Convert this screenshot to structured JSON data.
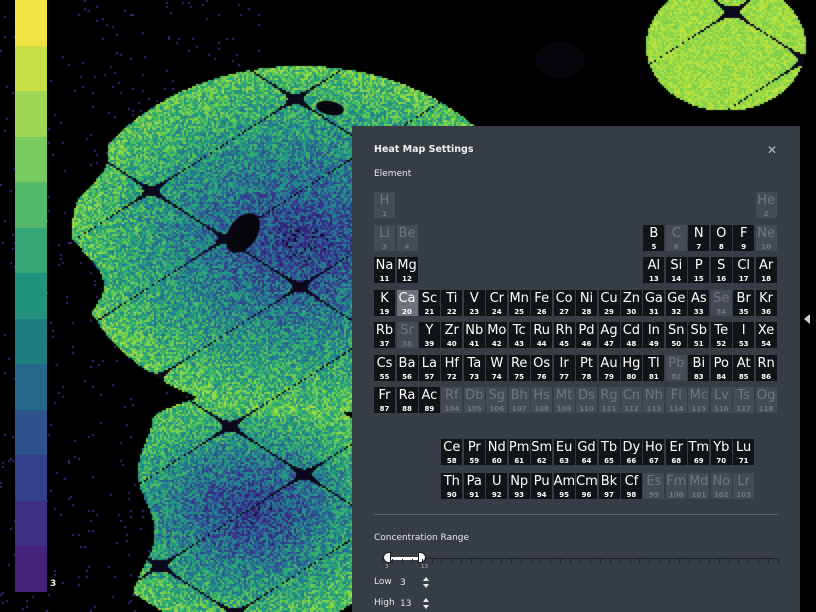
{
  "colorbar": {
    "label": "3",
    "colors": [
      "#f0e442",
      "#c8df48",
      "#9fd653",
      "#78c95e",
      "#54b86b",
      "#35a676",
      "#22927c",
      "#1f7e82",
      "#256889",
      "#2e538c",
      "#35408c",
      "#3b2f86",
      "#43237a"
    ]
  },
  "panel": {
    "title": "Heat Map Settings",
    "element_label": "Element",
    "selected_element": "Ca",
    "elements": [
      {
        "s": "H",
        "n": 1,
        "active": false
      },
      {
        "s": "He",
        "n": 2,
        "active": false
      },
      {
        "s": "Li",
        "n": 3,
        "active": false
      },
      {
        "s": "Be",
        "n": 4,
        "active": false
      },
      {
        "s": "B",
        "n": 5,
        "active": true
      },
      {
        "s": "C",
        "n": 6,
        "active": false
      },
      {
        "s": "N",
        "n": 7,
        "active": true
      },
      {
        "s": "O",
        "n": 8,
        "active": true
      },
      {
        "s": "F",
        "n": 9,
        "active": true
      },
      {
        "s": "Ne",
        "n": 10,
        "active": false
      },
      {
        "s": "Na",
        "n": 11,
        "active": true
      },
      {
        "s": "Mg",
        "n": 12,
        "active": true
      },
      {
        "s": "Al",
        "n": 13,
        "active": true
      },
      {
        "s": "Si",
        "n": 14,
        "active": true
      },
      {
        "s": "P",
        "n": 15,
        "active": true
      },
      {
        "s": "S",
        "n": 16,
        "active": true
      },
      {
        "s": "Cl",
        "n": 17,
        "active": true
      },
      {
        "s": "Ar",
        "n": 18,
        "active": true
      },
      {
        "s": "K",
        "n": 19,
        "active": true
      },
      {
        "s": "Ca",
        "n": 20,
        "active": true
      },
      {
        "s": "Sc",
        "n": 21,
        "active": true
      },
      {
        "s": "Ti",
        "n": 22,
        "active": true
      },
      {
        "s": "V",
        "n": 23,
        "active": true
      },
      {
        "s": "Cr",
        "n": 24,
        "active": true
      },
      {
        "s": "Mn",
        "n": 25,
        "active": true
      },
      {
        "s": "Fe",
        "n": 26,
        "active": true
      },
      {
        "s": "Co",
        "n": 27,
        "active": true
      },
      {
        "s": "Ni",
        "n": 28,
        "active": true
      },
      {
        "s": "Cu",
        "n": 29,
        "active": true
      },
      {
        "s": "Zn",
        "n": 30,
        "active": true
      },
      {
        "s": "Ga",
        "n": 31,
        "active": true
      },
      {
        "s": "Ge",
        "n": 32,
        "active": true
      },
      {
        "s": "As",
        "n": 33,
        "active": true
      },
      {
        "s": "Se",
        "n": 34,
        "active": false
      },
      {
        "s": "Br",
        "n": 35,
        "active": true
      },
      {
        "s": "Kr",
        "n": 36,
        "active": true
      },
      {
        "s": "Rb",
        "n": 37,
        "active": true
      },
      {
        "s": "Sr",
        "n": 38,
        "active": false
      },
      {
        "s": "Y",
        "n": 39,
        "active": true
      },
      {
        "s": "Zr",
        "n": 40,
        "active": true
      },
      {
        "s": "Nb",
        "n": 41,
        "active": true
      },
      {
        "s": "Mo",
        "n": 42,
        "active": true
      },
      {
        "s": "Tc",
        "n": 43,
        "active": true
      },
      {
        "s": "Ru",
        "n": 44,
        "active": true
      },
      {
        "s": "Rh",
        "n": 45,
        "active": true
      },
      {
        "s": "Pd",
        "n": 46,
        "active": true
      },
      {
        "s": "Ag",
        "n": 47,
        "active": true
      },
      {
        "s": "Cd",
        "n": 48,
        "active": true
      },
      {
        "s": "In",
        "n": 49,
        "active": true
      },
      {
        "s": "Sn",
        "n": 50,
        "active": true
      },
      {
        "s": "Sb",
        "n": 51,
        "active": true
      },
      {
        "s": "Te",
        "n": 52,
        "active": true
      },
      {
        "s": "I",
        "n": 53,
        "active": true
      },
      {
        "s": "Xe",
        "n": 54,
        "active": true
      },
      {
        "s": "Cs",
        "n": 55,
        "active": true
      },
      {
        "s": "Ba",
        "n": 56,
        "active": true
      },
      {
        "s": "La",
        "n": 57,
        "active": true
      },
      {
        "s": "Hf",
        "n": 72,
        "active": true
      },
      {
        "s": "Ta",
        "n": 73,
        "active": true
      },
      {
        "s": "W",
        "n": 74,
        "active": true
      },
      {
        "s": "Re",
        "n": 75,
        "active": true
      },
      {
        "s": "Os",
        "n": 76,
        "active": true
      },
      {
        "s": "Ir",
        "n": 77,
        "active": true
      },
      {
        "s": "Pt",
        "n": 78,
        "active": true
      },
      {
        "s": "Au",
        "n": 79,
        "active": true
      },
      {
        "s": "Hg",
        "n": 80,
        "active": true
      },
      {
        "s": "Tl",
        "n": 81,
        "active": true
      },
      {
        "s": "Pb",
        "n": 82,
        "active": false
      },
      {
        "s": "Bi",
        "n": 83,
        "active": true
      },
      {
        "s": "Po",
        "n": 84,
        "active": true
      },
      {
        "s": "At",
        "n": 85,
        "active": true
      },
      {
        "s": "Rn",
        "n": 86,
        "active": true
      },
      {
        "s": "Fr",
        "n": 87,
        "active": true
      },
      {
        "s": "Ra",
        "n": 88,
        "active": true
      },
      {
        "s": "Ac",
        "n": 89,
        "active": true
      },
      {
        "s": "Rf",
        "n": 104,
        "active": false
      },
      {
        "s": "Db",
        "n": 105,
        "active": false
      },
      {
        "s": "Sg",
        "n": 106,
        "active": false
      },
      {
        "s": "Bh",
        "n": 107,
        "active": false
      },
      {
        "s": "Hs",
        "n": 108,
        "active": false
      },
      {
        "s": "Mt",
        "n": 109,
        "active": false
      },
      {
        "s": "Ds",
        "n": 110,
        "active": false
      },
      {
        "s": "Rg",
        "n": 111,
        "active": false
      },
      {
        "s": "Cn",
        "n": 112,
        "active": false
      },
      {
        "s": "Nh",
        "n": 113,
        "active": false
      },
      {
        "s": "Fl",
        "n": 114,
        "active": false
      },
      {
        "s": "Mc",
        "n": 115,
        "active": false
      },
      {
        "s": "Lv",
        "n": 116,
        "active": false
      },
      {
        "s": "Ts",
        "n": 117,
        "active": false
      },
      {
        "s": "Og",
        "n": 118,
        "active": false
      },
      {
        "s": "Ce",
        "n": 58,
        "active": true
      },
      {
        "s": "Pr",
        "n": 59,
        "active": true
      },
      {
        "s": "Nd",
        "n": 60,
        "active": true
      },
      {
        "s": "Pm",
        "n": 61,
        "active": true
      },
      {
        "s": "Sm",
        "n": 62,
        "active": true
      },
      {
        "s": "Eu",
        "n": 63,
        "active": true
      },
      {
        "s": "Gd",
        "n": 64,
        "active": true
      },
      {
        "s": "Tb",
        "n": 65,
        "active": true
      },
      {
        "s": "Dy",
        "n": 66,
        "active": true
      },
      {
        "s": "Ho",
        "n": 67,
        "active": true
      },
      {
        "s": "Er",
        "n": 68,
        "active": true
      },
      {
        "s": "Tm",
        "n": 69,
        "active": true
      },
      {
        "s": "Yb",
        "n": 70,
        "active": true
      },
      {
        "s": "Lu",
        "n": 71,
        "active": true
      },
      {
        "s": "Th",
        "n": 90,
        "active": true
      },
      {
        "s": "Pa",
        "n": 91,
        "active": true
      },
      {
        "s": "U",
        "n": 92,
        "active": true
      },
      {
        "s": "Np",
        "n": 93,
        "active": true
      },
      {
        "s": "Pu",
        "n": 94,
        "active": true
      },
      {
        "s": "Am",
        "n": 95,
        "active": true
      },
      {
        "s": "Cm",
        "n": 96,
        "active": true
      },
      {
        "s": "Bk",
        "n": 97,
        "active": true
      },
      {
        "s": "Cf",
        "n": 98,
        "active": true
      },
      {
        "s": "Es",
        "n": 99,
        "active": false
      },
      {
        "s": "Fm",
        "n": 100,
        "active": false
      },
      {
        "s": "Md",
        "n": 101,
        "active": false
      },
      {
        "s": "No",
        "n": 102,
        "active": false
      },
      {
        "s": "Lr",
        "n": 103,
        "active": false
      }
    ],
    "concentration": {
      "label": "Concentration Range",
      "low_label": "Low",
      "high_label": "High",
      "low": "3",
      "high": "13",
      "min": 0,
      "max": 100
    }
  },
  "colors": {
    "panel_bg": "#373d44",
    "cell_active": "#111417",
    "cell_inactive": "#454b52",
    "cell_selected": "#6c737b"
  }
}
